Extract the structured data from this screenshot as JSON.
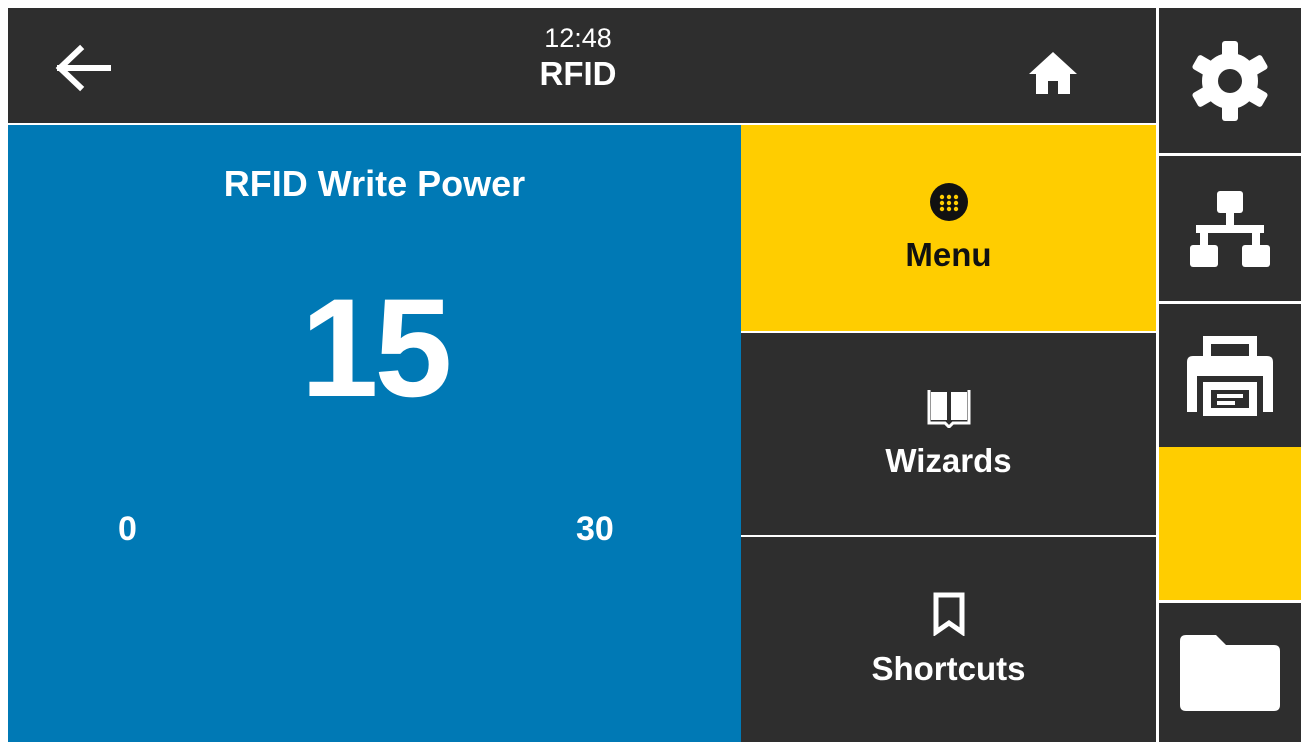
{
  "header": {
    "time": "12:48",
    "title": "RFID"
  },
  "setting": {
    "name": "RFID Write Power",
    "value": "15",
    "min": "0",
    "max": "30"
  },
  "nav": {
    "menu_label": "Menu",
    "wizards_label": "Wizards",
    "shortcuts_label": "Shortcuts"
  },
  "icons": {
    "back": "arrow-left-icon",
    "home": "home-icon",
    "menu": "grid-dots-icon",
    "wizards": "book-icon",
    "shortcuts": "bookmark-icon",
    "settings": "gear-icon",
    "network": "network-icon",
    "printer": "printer-icon",
    "files": "folder-icon"
  },
  "colors": {
    "accent_yellow": "#ffcd00",
    "value_panel_blue": "#0079b5",
    "dark_background": "#2e2e2e"
  }
}
